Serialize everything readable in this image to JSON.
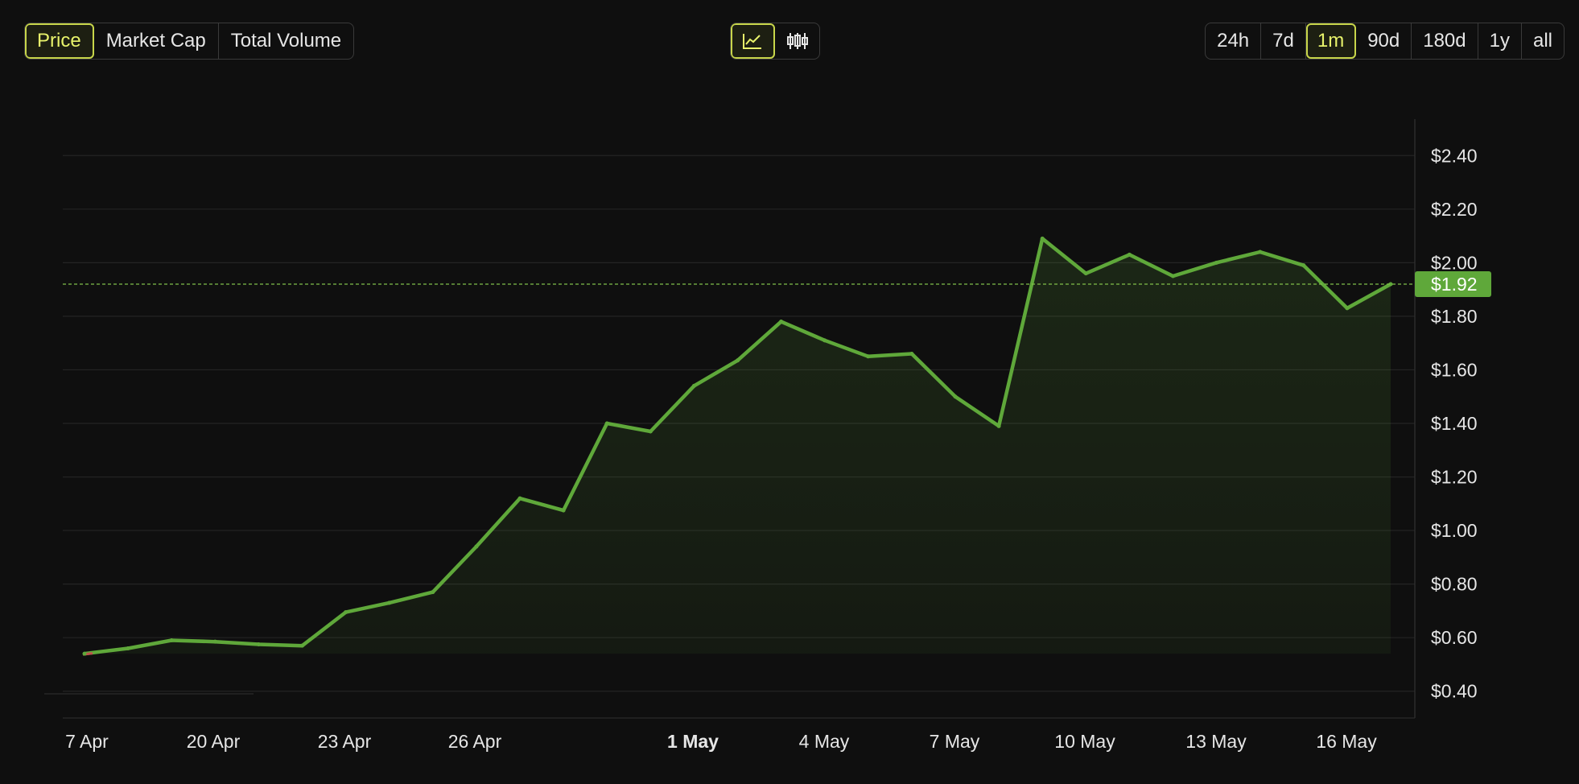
{
  "toolbar": {
    "metric_tabs": [
      {
        "label": "Price",
        "active": true
      },
      {
        "label": "Market Cap",
        "active": false
      },
      {
        "label": "Total Volume",
        "active": false
      }
    ],
    "chart_types": [
      {
        "icon": "line-chart-icon",
        "active": true
      },
      {
        "icon": "candlestick-icon",
        "active": false
      }
    ],
    "range_tabs": [
      {
        "label": "24h",
        "active": false
      },
      {
        "label": "7d",
        "active": false
      },
      {
        "label": "1m",
        "active": true
      },
      {
        "label": "90d",
        "active": false
      },
      {
        "label": "180d",
        "active": false
      },
      {
        "label": "1y",
        "active": false
      },
      {
        "label": "all",
        "active": false
      }
    ]
  },
  "colors": {
    "accent": "#e8f36b",
    "line": "#5fa83a",
    "current_tag": "#5fa83a",
    "grid": "#242424",
    "background": "#0f0f0f"
  },
  "chart_data": {
    "type": "area",
    "ylim": [
      0.3,
      2.53
    ],
    "y_ticks": [
      {
        "value": 2.4,
        "label": "$2.40"
      },
      {
        "value": 2.2,
        "label": "$2.20"
      },
      {
        "value": 2.0,
        "label": "$2.00"
      },
      {
        "value": 1.8,
        "label": "$1.80"
      },
      {
        "value": 1.6,
        "label": "$1.60"
      },
      {
        "value": 1.4,
        "label": "$1.40"
      },
      {
        "value": 1.2,
        "label": "$1.20"
      },
      {
        "value": 1.0,
        "label": "$1.00"
      },
      {
        "value": 0.8,
        "label": "$0.80"
      },
      {
        "value": 0.6,
        "label": "$0.60"
      },
      {
        "value": 0.4,
        "label": "$0.40"
      }
    ],
    "x_ticks": [
      {
        "label": "7 Apr",
        "bold": false
      },
      {
        "label": "20 Apr",
        "bold": false
      },
      {
        "label": "23 Apr",
        "bold": false
      },
      {
        "label": "26 Apr",
        "bold": false
      },
      {
        "label": "1 May",
        "bold": true
      },
      {
        "label": "4 May",
        "bold": false
      },
      {
        "label": "7 May",
        "bold": false
      },
      {
        "label": "10 May",
        "bold": false
      },
      {
        "label": "13 May",
        "bold": false
      },
      {
        "label": "16 May",
        "bold": false
      }
    ],
    "values": [
      0.54,
      0.56,
      0.59,
      0.585,
      0.575,
      0.57,
      0.695,
      0.73,
      0.77,
      0.94,
      1.12,
      1.075,
      1.4,
      1.37,
      1.54,
      1.635,
      1.78,
      1.71,
      1.65,
      1.66,
      1.5,
      1.39,
      2.09,
      1.96,
      2.03,
      1.95,
      2.0,
      2.04,
      1.99,
      1.83,
      1.92
    ],
    "current_value": 1.92,
    "current_label": "$1.92"
  }
}
